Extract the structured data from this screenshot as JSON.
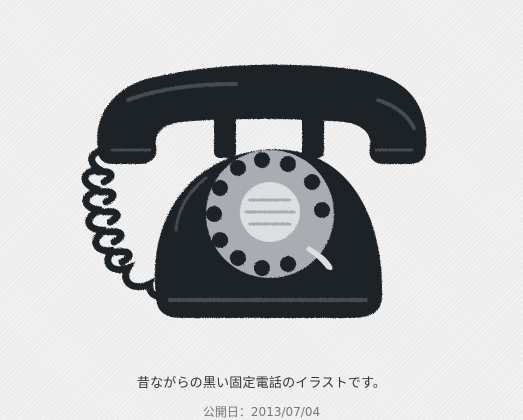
{
  "illustration": {
    "icon": "rotary-telephone-icon",
    "body_color": "#1f2328",
    "highlight_color": "#454b52",
    "dial_color": "#a9adb1",
    "dial_center_color": "#dcdfe2",
    "dial_hole_color": "#1f2328"
  },
  "caption": {
    "text": "昔ながらの黒い固定電話のイラストです。"
  },
  "published": {
    "label": "公開日：",
    "date": "2013/07/04"
  }
}
